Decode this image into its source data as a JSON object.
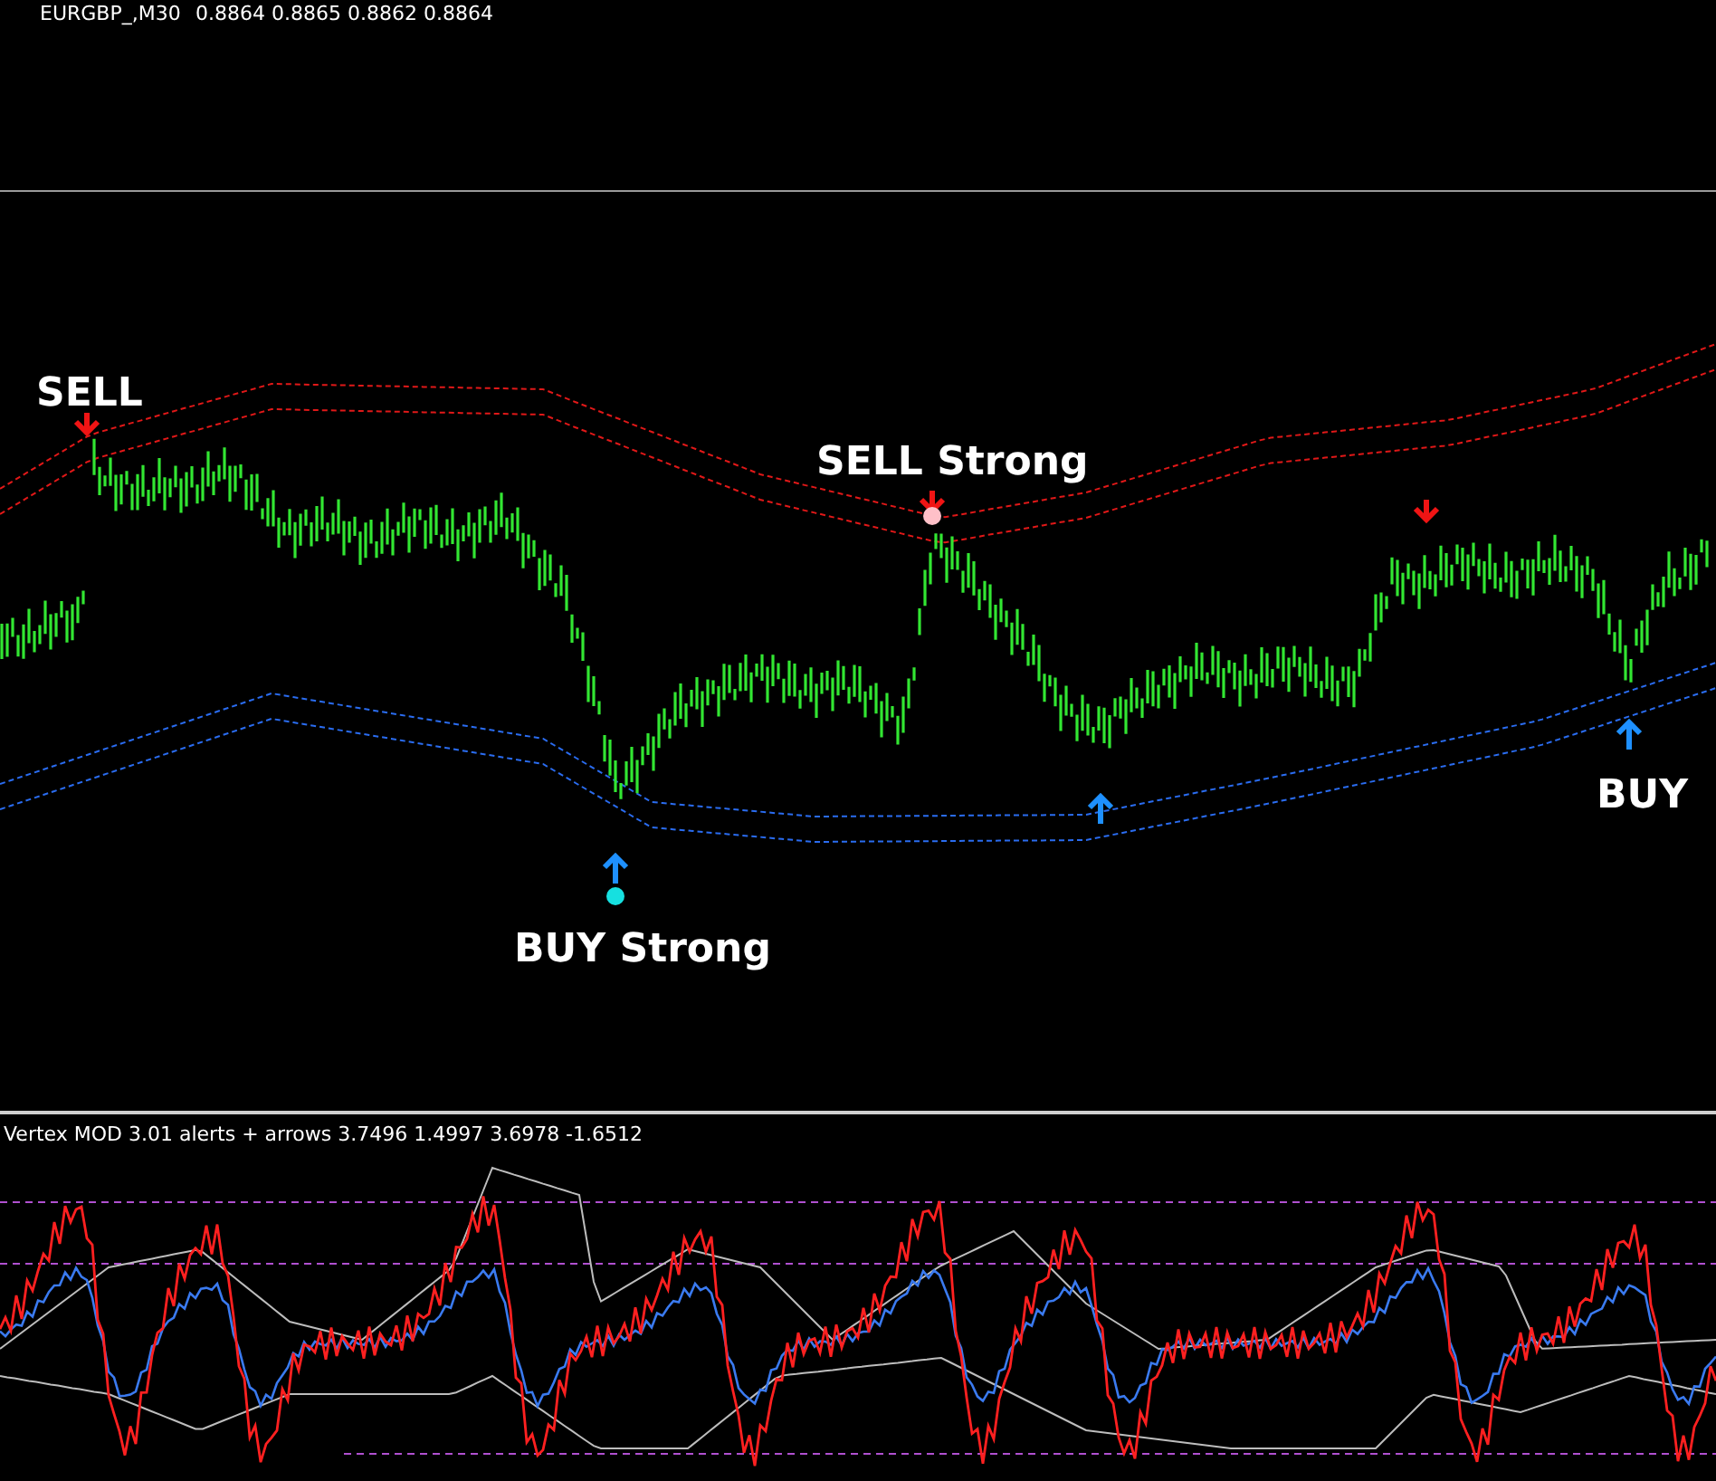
{
  "header": {
    "symbol": "EURGBP_,M30",
    "quotes": "0.8864 0.8865 0.8862 0.8864"
  },
  "signals": [
    {
      "kind": "sell",
      "strong": false,
      "label": "SELL"
    },
    {
      "kind": "sell",
      "strong": true,
      "label": "SELL Strong"
    },
    {
      "kind": "sell",
      "strong": false
    },
    {
      "kind": "buy",
      "strong": true,
      "label": "BUY Strong"
    },
    {
      "kind": "buy",
      "strong": false
    },
    {
      "kind": "buy",
      "strong": false,
      "label": "BUY"
    }
  ],
  "indicator": {
    "title": "Vertex MOD 3.01 alerts + arrows 3.7496 1.4997 3.6978 -1.6512"
  }
}
